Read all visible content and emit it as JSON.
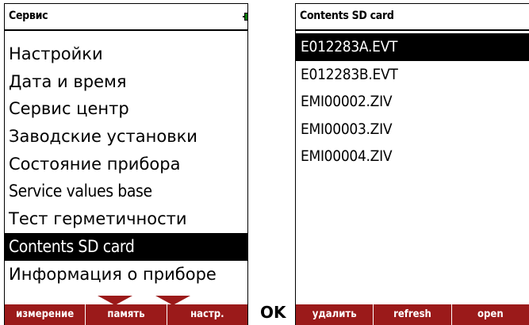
{
  "left_screen": {
    "title": "Сервис",
    "menu": [
      {
        "label": "Настройки"
      },
      {
        "label": "Дата и время"
      },
      {
        "label": "Сервис центр"
      },
      {
        "label": "Заводские установки"
      },
      {
        "label": "Состояние прибора"
      },
      {
        "label": "Service values base"
      },
      {
        "label": "Тест герметичности"
      },
      {
        "label": "Contents SD card",
        "selected": true
      },
      {
        "label": "Информация о приборе"
      }
    ],
    "softkeys": [
      "измерение",
      "память",
      "настр."
    ]
  },
  "ok_label": "OK",
  "right_screen": {
    "title": "Contents SD card",
    "files": [
      {
        "name": "E012283A.EVT",
        "selected": true
      },
      {
        "name": "E012283B.EVT"
      },
      {
        "name": "EMI00002.ZIV"
      },
      {
        "name": "EMI00003.ZIV"
      },
      {
        "name": "EMI00004.ZIV"
      }
    ],
    "softkeys": [
      "удалить",
      "refresh",
      "open"
    ]
  },
  "status_icons": [
    "power-plug-icon",
    "signal-icon",
    "battery-icon",
    "battery-icon"
  ],
  "colors": {
    "softkey_bar": "#9b1a1a",
    "status_green": "#22cc22",
    "selection": "#000000"
  }
}
